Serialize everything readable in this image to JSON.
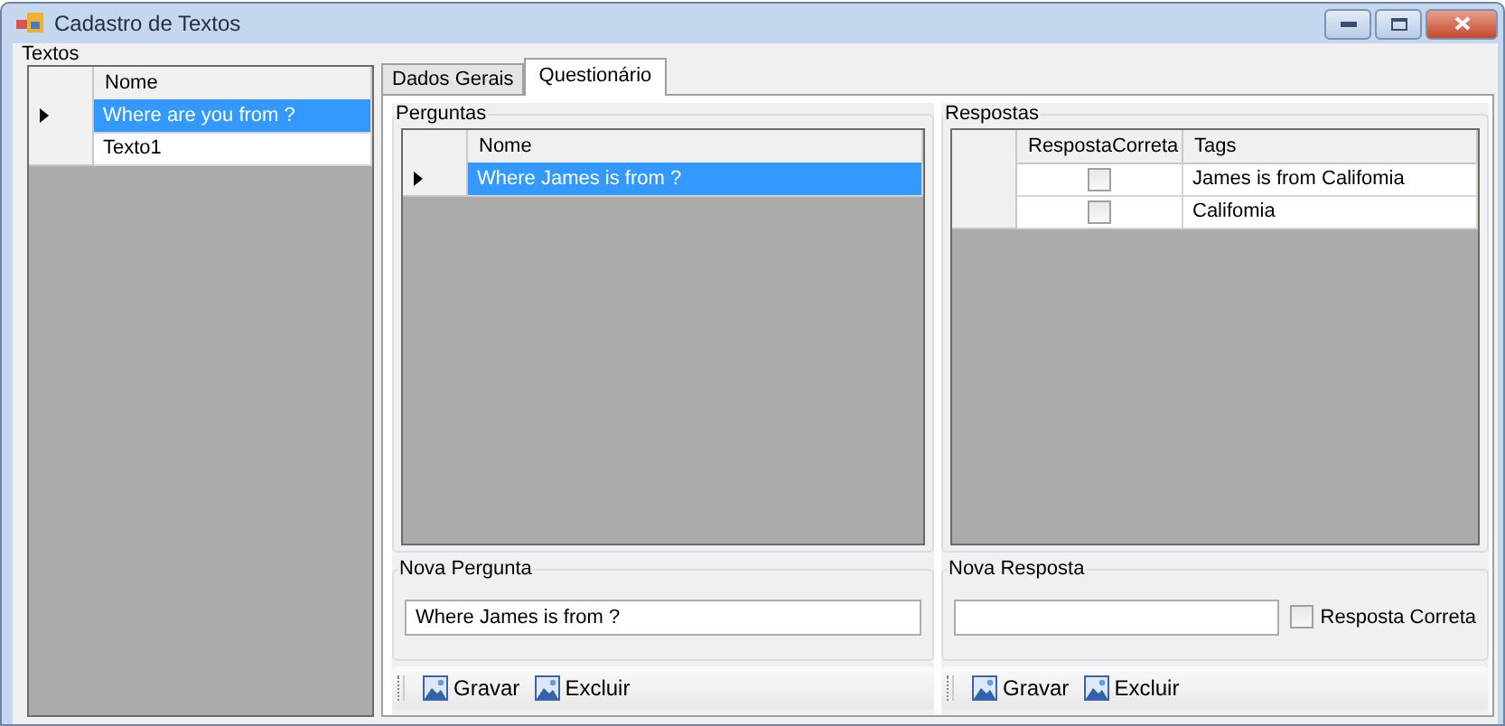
{
  "window": {
    "title": "Cadastro de Textos"
  },
  "textos": {
    "label": "Textos",
    "columns": [
      {
        "label": "Nome"
      }
    ],
    "rows": [
      {
        "cells": [
          "Where are you from ?"
        ],
        "selected": true
      },
      {
        "cells": [
          "Texto1"
        ],
        "selected": false
      }
    ]
  },
  "tabs": [
    {
      "label": "Dados Gerais",
      "selected": false
    },
    {
      "label": "Questionário",
      "selected": true
    }
  ],
  "perguntas": {
    "label": "Perguntas",
    "columns": [
      {
        "label": "Nome"
      }
    ],
    "rows": [
      {
        "cells": [
          "Where James is from ?"
        ],
        "selected": true
      }
    ]
  },
  "respostas": {
    "label": "Respostas",
    "columns": [
      {
        "label": "RespostaCorreta",
        "kind": "check"
      },
      {
        "label": "Tags",
        "kind": "text"
      }
    ],
    "rows": [
      {
        "cells": [
          false,
          "James is from Califomia"
        ],
        "selected": false
      },
      {
        "cells": [
          false,
          "Califomia"
        ],
        "selected": false
      }
    ]
  },
  "nova_pergunta": {
    "label": "Nova  Pergunta",
    "value": "Where James is from ?",
    "buttons": [
      "Gravar",
      "Excluir"
    ]
  },
  "nova_resposta": {
    "label": "Nova  Resposta",
    "checkbox": {
      "label": "Resposta Correta",
      "checked": false
    },
    "buttons": [
      "Gravar",
      "Excluir"
    ]
  }
}
